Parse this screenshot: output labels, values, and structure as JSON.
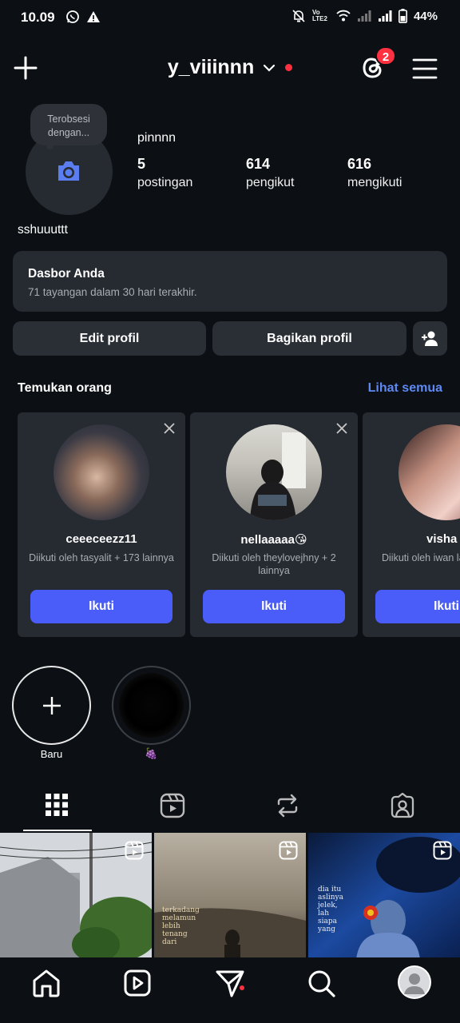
{
  "status_bar": {
    "time": "10.09",
    "battery": "44%",
    "network": "Vo LTE2"
  },
  "header": {
    "username": "y_viiinnn",
    "threads_badge": "2"
  },
  "profile": {
    "note": "Terobsesi dengan...",
    "display_name": "pinnnn",
    "posts_count": "5",
    "posts_label": "postingan",
    "followers_count": "614",
    "followers_label": "pengikut",
    "following_count": "616",
    "following_label": "mengikuti",
    "bio": "sshuuuttt"
  },
  "dashboard": {
    "title": "Dasbor Anda",
    "subtitle": "71 tayangan dalam 30 hari terakhir."
  },
  "actions": {
    "edit_profile": "Edit profil",
    "share_profile": "Bagikan profil"
  },
  "discover": {
    "title": "Temukan orang",
    "see_all": "Lihat semua",
    "cards": [
      {
        "name": "ceeeceezz11",
        "subtitle": "Diikuti oleh tasyalit + 173 lainnya",
        "follow": "Ikuti"
      },
      {
        "name": "nellaaaaa😘",
        "subtitle": "Diikuti oleh theylovejhny + 2 lainnya",
        "follow": "Ikuti"
      },
      {
        "name": "visha",
        "subtitle": "Diikuti oleh iwan lainnya",
        "follow": "Ikuti"
      }
    ]
  },
  "highlights": [
    {
      "label": "Baru"
    },
    {
      "label": "🍇"
    }
  ],
  "grid": {
    "posts": [
      {
        "overlay": ""
      },
      {
        "overlay": "terkadang melamun lebih tenang dari"
      },
      {
        "overlay": "dia itu aslinya jelek, lah siapa yang"
      }
    ]
  },
  "colors": {
    "background": "#0c1014",
    "surface": "#262a31",
    "accent_blue": "#4a5df9",
    "link_blue": "#5e89f5",
    "notification_red": "#ff3040"
  }
}
